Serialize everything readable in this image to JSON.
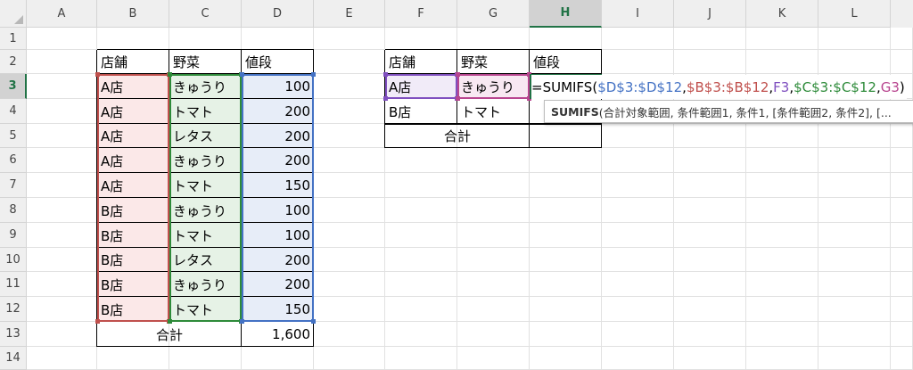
{
  "columns": [
    "A",
    "B",
    "C",
    "D",
    "E",
    "F",
    "G",
    "H",
    "I",
    "J",
    "K",
    "L"
  ],
  "rows": [
    "1",
    "2",
    "3",
    "4",
    "5",
    "6",
    "7",
    "8",
    "9",
    "10",
    "11",
    "12",
    "13",
    "14"
  ],
  "selected": {
    "column": "H",
    "row": "3"
  },
  "left_table": {
    "headers": [
      "店舗",
      "野菜",
      "値段"
    ],
    "rows": [
      [
        "A店",
        "きゅうり",
        "100"
      ],
      [
        "A店",
        "トマト",
        "200"
      ],
      [
        "A店",
        "レタス",
        "200"
      ],
      [
        "A店",
        "きゅうり",
        "200"
      ],
      [
        "A店",
        "トマト",
        "150"
      ],
      [
        "B店",
        "きゅうり",
        "100"
      ],
      [
        "B店",
        "トマト",
        "100"
      ],
      [
        "B店",
        "レタス",
        "200"
      ],
      [
        "B店",
        "きゅうり",
        "200"
      ],
      [
        "B店",
        "トマト",
        "150"
      ]
    ],
    "total_label": "合計",
    "total_value": "1,600"
  },
  "right_table": {
    "headers": [
      "店舗",
      "野菜",
      "値段"
    ],
    "rows": [
      [
        "A店",
        "きゅうり"
      ],
      [
        "B店",
        "トマト"
      ]
    ],
    "total_label": "合計"
  },
  "formula": {
    "prefix": "=SUMIFS(",
    "arg1": "$D$3:$D$12",
    "sep1": ",",
    "arg2": "$B$3:$B$12",
    "sep2": ",",
    "arg3": "F3",
    "sep3": ",",
    "arg4": "$C$3:$C$12",
    "sep4": ",",
    "arg5": "G3",
    "suffix": ")"
  },
  "tooltip": {
    "function_name": "SUMIFS",
    "signature": "(合計対象範囲, 条件範囲1, 条件1, [条件範囲2, 条件2], [..."
  },
  "colors": {
    "grid": "#e1e1e1",
    "header_bg": "#efefef",
    "selected_accent": "#217346",
    "range_blue": "#4472c4",
    "range_red": "#c0504d",
    "range_purple": "#7f4fbf",
    "range_green": "#2e8b3a",
    "range_pink": "#b8458f"
  }
}
